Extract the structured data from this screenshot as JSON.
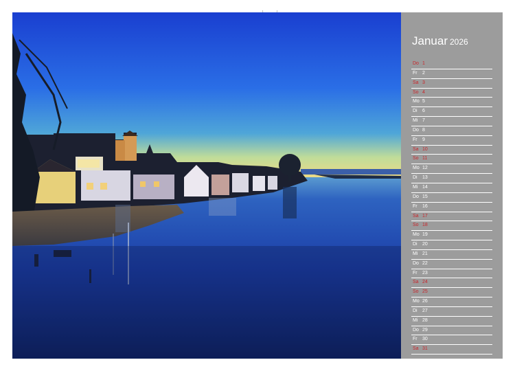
{
  "calendar": {
    "month": "Januar",
    "year": "2026",
    "weekend_color": "#c9252a",
    "sidebar_color": "#9c9c9c",
    "days": [
      {
        "weekday": "Do",
        "day": "1",
        "weekend": true
      },
      {
        "weekday": "Fr",
        "day": "2",
        "weekend": false
      },
      {
        "weekday": "Sa",
        "day": "3",
        "weekend": true
      },
      {
        "weekday": "So",
        "day": "4",
        "weekend": true
      },
      {
        "weekday": "Mo",
        "day": "5",
        "weekend": false
      },
      {
        "weekday": "Di",
        "day": "6",
        "weekend": false
      },
      {
        "weekday": "Mi",
        "day": "7",
        "weekend": false
      },
      {
        "weekday": "Do",
        "day": "8",
        "weekend": false
      },
      {
        "weekday": "Fr",
        "day": "9",
        "weekend": false
      },
      {
        "weekday": "Sa",
        "day": "10",
        "weekend": true
      },
      {
        "weekday": "So",
        "day": "11",
        "weekend": true
      },
      {
        "weekday": "Mo",
        "day": "12",
        "weekend": false
      },
      {
        "weekday": "Di",
        "day": "13",
        "weekend": false
      },
      {
        "weekday": "Mi",
        "day": "14",
        "weekend": false
      },
      {
        "weekday": "Do",
        "day": "15",
        "weekend": false
      },
      {
        "weekday": "Fr",
        "day": "16",
        "weekend": false
      },
      {
        "weekday": "Sa",
        "day": "17",
        "weekend": true
      },
      {
        "weekday": "So",
        "day": "18",
        "weekend": true
      },
      {
        "weekday": "Mo",
        "day": "19",
        "weekend": false
      },
      {
        "weekday": "Di",
        "day": "20",
        "weekend": false
      },
      {
        "weekday": "Mi",
        "day": "21",
        "weekend": false
      },
      {
        "weekday": "Do",
        "day": "22",
        "weekend": false
      },
      {
        "weekday": "Fr",
        "day": "23",
        "weekend": false
      },
      {
        "weekday": "Sa",
        "day": "24",
        "weekend": true
      },
      {
        "weekday": "So",
        "day": "25",
        "weekend": true
      },
      {
        "weekday": "Mo",
        "day": "26",
        "weekend": false
      },
      {
        "weekday": "Di",
        "day": "27",
        "weekend": false
      },
      {
        "weekday": "Mi",
        "day": "28",
        "weekend": false
      },
      {
        "weekday": "Do",
        "day": "29",
        "weekend": false
      },
      {
        "weekday": "Fr",
        "day": "30",
        "weekend": false
      },
      {
        "weekday": "Sa",
        "day": "31",
        "weekend": true
      }
    ]
  }
}
